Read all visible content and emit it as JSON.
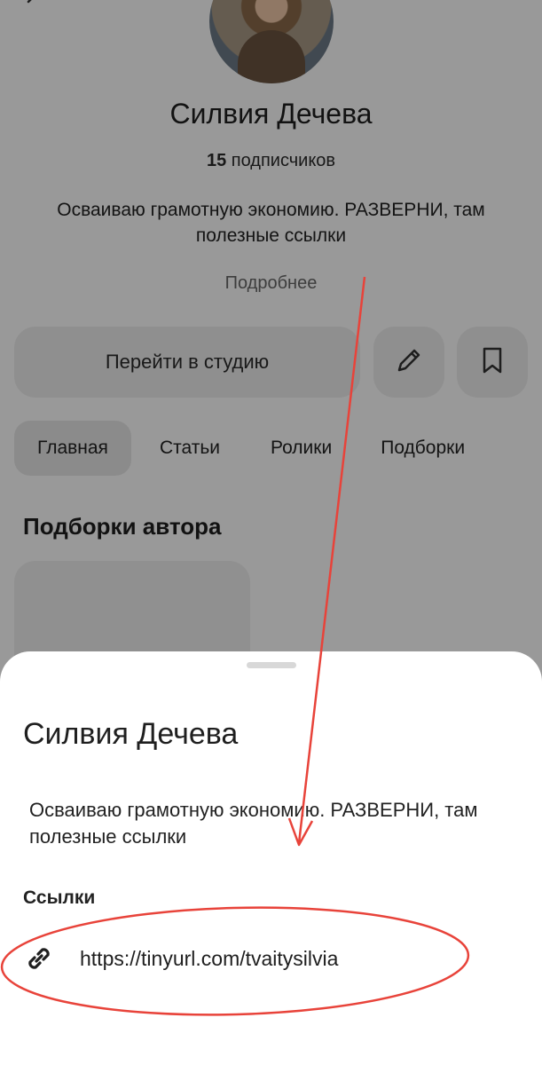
{
  "profile": {
    "name": "Силвия Дечева",
    "subscribers_count": "15",
    "subscribers_label": "подписчиков",
    "bio": "Осваиваю грамотную экономию. РАЗВЕРНИ, там полезные ссылки",
    "more_label": "Подробнее"
  },
  "actions": {
    "studio_label": "Перейти в студию",
    "edit_icon": "pencil-icon",
    "bookmark_icon": "bookmark-icon"
  },
  "tabs": [
    {
      "label": "Главная",
      "active": true
    },
    {
      "label": "Статьи",
      "active": false
    },
    {
      "label": "Ролики",
      "active": false
    },
    {
      "label": "Подборки",
      "active": false
    }
  ],
  "section": {
    "title": "Подборки автора"
  },
  "sheet": {
    "name": "Силвия Дечева",
    "bio": "Осваиваю грамотную экономию. РАЗВЕРНИ, там полезные ссылки",
    "links_title": "Ссылки",
    "links": [
      {
        "icon": "link-icon",
        "url": "https://tinyurl.com/tvaitysilvia"
      }
    ]
  },
  "colors": {
    "annotation": "#e8433a",
    "overlay": "rgba(0,0,0,0.40)"
  }
}
